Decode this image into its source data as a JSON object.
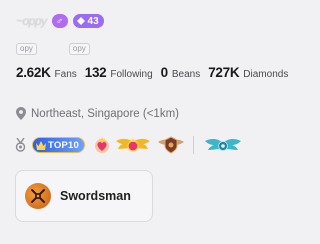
{
  "profile": {
    "username": "~oppy",
    "gender_badge": "♂",
    "level_badge": "43",
    "copy_chips": [
      "opy",
      "opy"
    ]
  },
  "stats": [
    {
      "value": "2.62K",
      "label": "Fans"
    },
    {
      "value": "132",
      "label": "Following"
    },
    {
      "value": "0",
      "label": "Beans"
    },
    {
      "value": "727K",
      "label": "Diamonds"
    }
  ],
  "location": {
    "text": "Northeast, Singapore (<1km)",
    "icon": "location-pin-icon"
  },
  "honors": {
    "top_badge_label": "TOP10",
    "icons": [
      "medal-icon",
      "crown-badge-icon",
      "heart-badge-icon",
      "golden-wings-icon",
      "emblem-badge-icon",
      "blue-wings-icon"
    ]
  },
  "family": {
    "name": "Swordsman",
    "icon": "swordsman-emblem-icon"
  },
  "colors": {
    "background": "#f1f1f4",
    "level_badge": "#9a6cf0",
    "gender_badge": "#b06cf0",
    "top_badge": "#2d5fe3"
  }
}
